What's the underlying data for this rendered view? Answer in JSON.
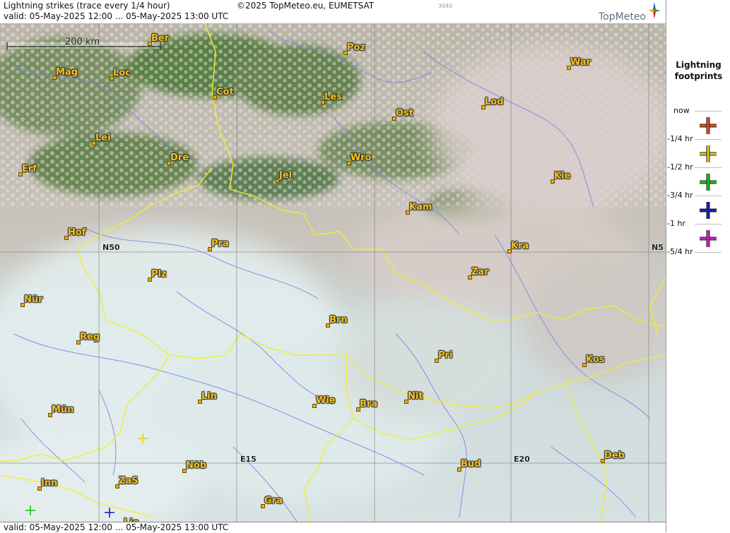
{
  "header": {
    "title": "Lightning strikes (trace every 1/4 hour)",
    "copyright": "©2025 TopMeteo.eu, EUMETSAT",
    "code": "3040",
    "valid": "valid:  05-May-2025 12:00 ... 05-May-2025 13:00 UTC",
    "logo_text": "TopMeteo"
  },
  "footer": {
    "valid": "valid:  05-May-2025 12:00 ... 05-May-2025 13:00 UTC"
  },
  "scale": {
    "label": "200 km"
  },
  "legend": {
    "title_line1": "Lightning",
    "title_line2": "footprints",
    "items": [
      {
        "label": "now",
        "color": "#e0501a"
      },
      {
        "label": "-1/4 hr",
        "color": "#e0d020"
      },
      {
        "label": "-1/2 hr",
        "color": "#20c020"
      },
      {
        "label": "-3/4 hr",
        "color": "#1020c0"
      },
      {
        "label": "-1 hr",
        "color": "#d020c0"
      },
      {
        "label": "-5/4 hr",
        "color": ""
      }
    ]
  },
  "grid_labels": {
    "n50_left": "N50",
    "n50_right": "N5",
    "e15": "E15",
    "e20": "E20"
  },
  "cities": [
    {
      "name": "Ber"
    },
    {
      "name": "Poz"
    },
    {
      "name": "War"
    },
    {
      "name": "Mag"
    },
    {
      "name": "Loc"
    },
    {
      "name": "Cot"
    },
    {
      "name": "Les"
    },
    {
      "name": "Lod"
    },
    {
      "name": "Ost"
    },
    {
      "name": "Lei"
    },
    {
      "name": "Wro"
    },
    {
      "name": "Erf"
    },
    {
      "name": "Dre"
    },
    {
      "name": "Jel"
    },
    {
      "name": "Kie"
    },
    {
      "name": "Kam"
    },
    {
      "name": "Hof"
    },
    {
      "name": "Pra"
    },
    {
      "name": "Kra"
    },
    {
      "name": "Plz"
    },
    {
      "name": "Zar"
    },
    {
      "name": "Nür"
    },
    {
      "name": "Brn"
    },
    {
      "name": "Reg"
    },
    {
      "name": "Pri"
    },
    {
      "name": "Kos"
    },
    {
      "name": "Lin"
    },
    {
      "name": "Nit"
    },
    {
      "name": "Wie"
    },
    {
      "name": "Bra"
    },
    {
      "name": "Mün"
    },
    {
      "name": "Deb"
    },
    {
      "name": "Nöb"
    },
    {
      "name": "Bud"
    },
    {
      "name": "Inn"
    },
    {
      "name": "ZaS"
    },
    {
      "name": "Gra"
    },
    {
      "name": "Lie"
    }
  ],
  "strikes": [
    {
      "age": "-1/4 hr",
      "color": "#e0d020"
    },
    {
      "age": "-1/2 hr",
      "color": "#20c020"
    },
    {
      "age": "-3/4 hr",
      "color": "#1020c0"
    }
  ]
}
